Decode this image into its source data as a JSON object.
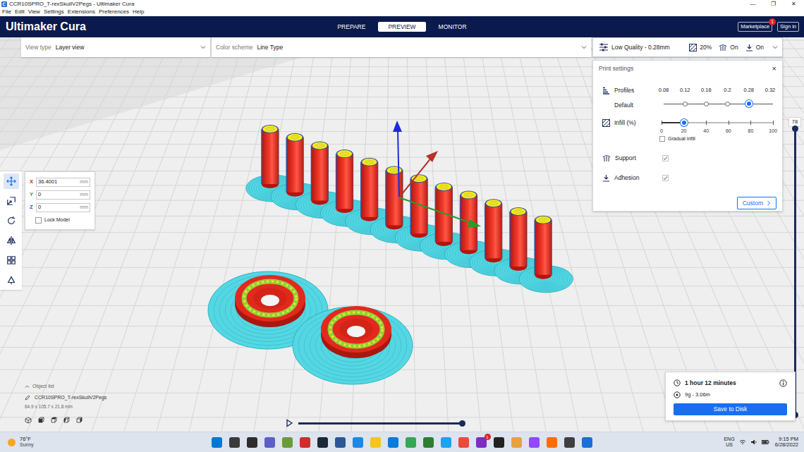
{
  "window": {
    "title": "CCR10SPRO_T-rexSkullV2Pegs - Ultimaker Cura",
    "controls": [
      "—",
      "❐",
      "✕"
    ]
  },
  "menu": [
    "File",
    "Edit",
    "View",
    "Settings",
    "Extensions",
    "Preferences",
    "Help"
  ],
  "header": {
    "logo": "Ultimaker Cura",
    "tabs": [
      {
        "label": "PREPARE",
        "selected": false
      },
      {
        "label": "PREVIEW",
        "selected": true
      },
      {
        "label": "MONITOR",
        "selected": false
      }
    ],
    "marketplace": {
      "label": "Marketplace",
      "badge": "1"
    },
    "sign_in": "Sign in"
  },
  "toolbar": {
    "view_type": {
      "label": "View type",
      "value": "Layer view"
    },
    "color_scheme": {
      "label": "Color scheme",
      "value": "Line Type"
    },
    "summary": {
      "profile": "Low Quality - 0.28mm",
      "infill": "20%",
      "support": "On",
      "adhesion": "On"
    }
  },
  "print_settings": {
    "title": "Print settings",
    "close": "×",
    "profiles": {
      "label": "Profiles",
      "value": "Default",
      "ticks": [
        {
          "label": "0.08",
          "available": false,
          "selected": false
        },
        {
          "label": "0.12",
          "available": true,
          "selected": false
        },
        {
          "label": "0.16",
          "available": true,
          "selected": false
        },
        {
          "label": "0.2",
          "available": true,
          "selected": false
        },
        {
          "label": "0.28",
          "available": true,
          "selected": true
        },
        {
          "label": "0.32",
          "available": false,
          "selected": false
        }
      ]
    },
    "infill": {
      "label": "Infill (%)",
      "ticks": [
        "0",
        "20",
        "40",
        "60",
        "80",
        "100"
      ],
      "level": 0.2,
      "gradual": {
        "label": "Gradual infill",
        "checked": false
      }
    },
    "support": {
      "label": "Support",
      "checked": true
    },
    "adhesion": {
      "label": "Adhesion",
      "checked": true
    },
    "custom": "Custom"
  },
  "tools": [
    {
      "kind": "move",
      "selected": true
    },
    {
      "kind": "scale",
      "selected": false
    },
    {
      "kind": "rotate",
      "selected": false
    },
    {
      "kind": "mirror",
      "selected": false
    },
    {
      "kind": "per-model-settings",
      "selected": false
    },
    {
      "kind": "support-blocker",
      "selected": false
    }
  ],
  "move_panel": {
    "fields": [
      {
        "axis": "X",
        "value": "36.4001",
        "unit": "mm",
        "color": "#d9261c"
      },
      {
        "axis": "Y",
        "value": "0",
        "unit": "mm",
        "color": "#3a9a3a"
      },
      {
        "axis": "Z",
        "value": "0",
        "unit": "mm",
        "color": "#2b47d6"
      }
    ],
    "lock": {
      "label": "Lock Model",
      "checked": false
    }
  },
  "layer_slider": {
    "value": "78",
    "level": 1
  },
  "object_list": {
    "label": "Object list",
    "name": "CCR10SPRO_T-rexSkullV2Pegs",
    "dimensions": "64.9 x 105.7 x 21.8 mm"
  },
  "playback": {
    "level": 1
  },
  "estimate": {
    "time": "1 hour 12 minutes",
    "material": "9g - 3.06m",
    "save": "Save to Disk"
  },
  "taskbar": {
    "weather": {
      "temp": "76°F",
      "condition": "Sunny"
    },
    "apps": [
      {
        "color": "#0078d4"
      },
      {
        "color": "#3a3a3a"
      },
      {
        "color": "#2d2d2d"
      },
      {
        "color": "#5b5fc7"
      },
      {
        "color": "#6b9b3a"
      },
      {
        "color": "#d12c2c"
      },
      {
        "color": "#1b2838"
      },
      {
        "color": "#2b5797"
      },
      {
        "color": "#1e88e5"
      },
      {
        "color": "#f5c518"
      },
      {
        "color": "#0a7bd8"
      },
      {
        "color": "#34a853"
      },
      {
        "color": "#2e7d32"
      },
      {
        "color": "#1da1f2"
      },
      {
        "color": "#e84c3d"
      },
      {
        "color": "#7b2fbe",
        "badge": "1"
      },
      {
        "color": "#222222"
      },
      {
        "color": "#e6a23c"
      },
      {
        "color": "#9146ff"
      },
      {
        "color": "#ff6d00"
      },
      {
        "color": "#3f3f3f"
      },
      {
        "color": "#1a6fd8"
      }
    ],
    "language": "ENG",
    "region": "US",
    "time": "9:15 PM",
    "date": "6/28/2022"
  }
}
